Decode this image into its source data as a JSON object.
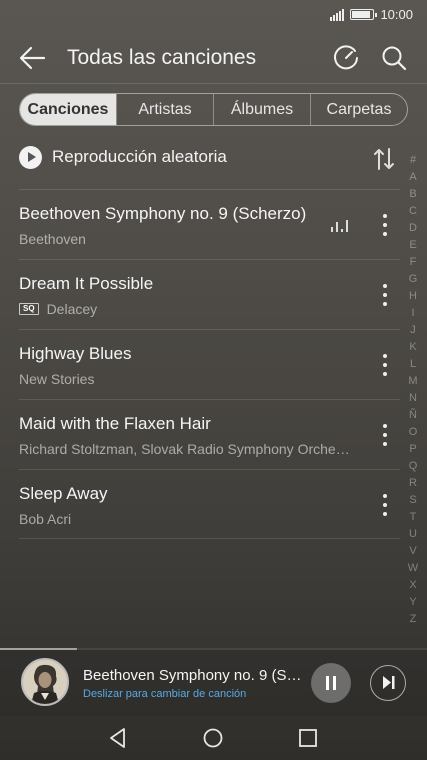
{
  "status_bar": {
    "time": "10:00",
    "battery_level": 0.9
  },
  "header": {
    "title": "Todas las canciones",
    "icons": [
      "back-arrow-icon",
      "timer-icon",
      "search-icon"
    ]
  },
  "tabs": [
    {
      "label": "Canciones",
      "active": true
    },
    {
      "label": "Artistas",
      "active": false
    },
    {
      "label": "Álbumes",
      "active": false
    },
    {
      "label": "Carpetas",
      "active": false
    }
  ],
  "shuffle": {
    "label": "Reproducción aleatoria"
  },
  "songs": [
    {
      "title": "Beethoven Symphony no. 9 (Scherzo)",
      "artist": "Beethoven",
      "playing": true,
      "sq": false
    },
    {
      "title": "Dream It Possible",
      "artist": "Delacey",
      "playing": false,
      "sq": true,
      "sq_label": "SQ"
    },
    {
      "title": "Highway Blues",
      "artist": "New Stories",
      "playing": false,
      "sq": false
    },
    {
      "title": "Maid with the Flaxen Hair",
      "artist": "Richard Stoltzman, Slovak Radio Symphony Orche…",
      "playing": false,
      "sq": false
    },
    {
      "title": "Sleep Away",
      "artist": "Bob Acri",
      "playing": false,
      "sq": false
    }
  ],
  "alpha_index": [
    "#",
    "A",
    "B",
    "C",
    "D",
    "E",
    "F",
    "G",
    "H",
    "I",
    "J",
    "K",
    "L",
    "M",
    "N",
    "Ñ",
    "O",
    "P",
    "Q",
    "R",
    "S",
    "T",
    "U",
    "V",
    "W",
    "X",
    "Y",
    "Z"
  ],
  "now_playing": {
    "title": "Beethoven Symphony no. 9 (S…",
    "hint": "Deslizar para cambiar de canción",
    "progress": 0.18
  },
  "colors": {
    "accent": "#5aa9e6"
  }
}
